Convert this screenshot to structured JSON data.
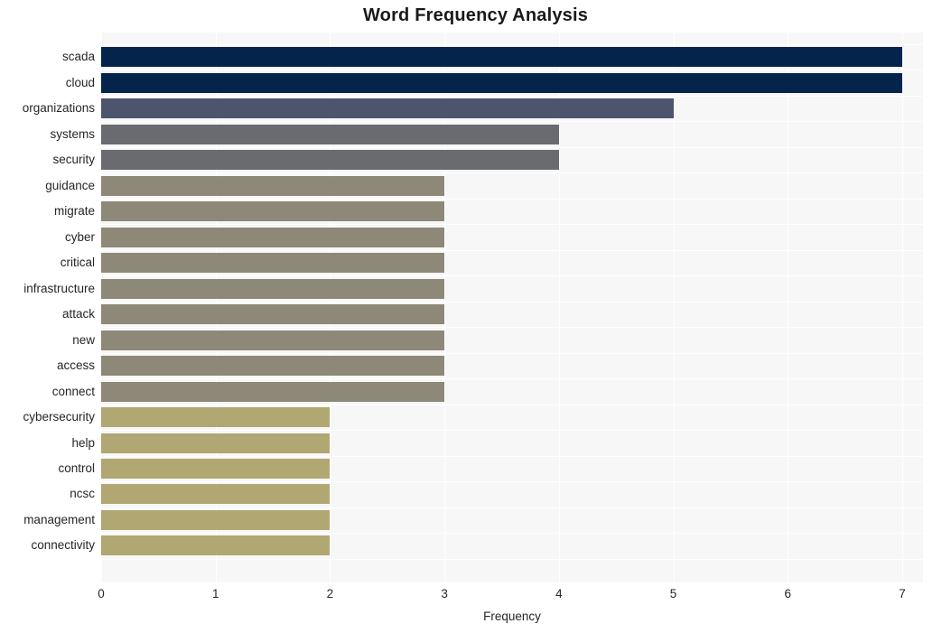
{
  "chart_data": {
    "type": "bar",
    "orientation": "horizontal",
    "title": "Word Frequency Analysis",
    "xlabel": "Frequency",
    "ylabel": "",
    "xlim": [
      0,
      7
    ],
    "xticks": [
      "0",
      "1",
      "2",
      "3",
      "4",
      "5",
      "6",
      "7"
    ],
    "grid": true,
    "legend": false,
    "categories": [
      "scada",
      "cloud",
      "organizations",
      "systems",
      "security",
      "guidance",
      "migrate",
      "cyber",
      "critical",
      "infrastructure",
      "attack",
      "new",
      "access",
      "connect",
      "cybersecurity",
      "help",
      "control",
      "ncsc",
      "management",
      "connectivity"
    ],
    "values": [
      7,
      7,
      5,
      4,
      4,
      3,
      3,
      3,
      3,
      3,
      3,
      3,
      3,
      3,
      2,
      2,
      2,
      2,
      2,
      2
    ],
    "bar_colors": [
      "#04244c",
      "#04244c",
      "#4d546d",
      "#6a6b70",
      "#6a6b70",
      "#8d8878",
      "#8d8878",
      "#8d8878",
      "#8d8878",
      "#8d8878",
      "#8d8878",
      "#8d8878",
      "#8d8878",
      "#8d8878",
      "#b0a772",
      "#b0a772",
      "#b0a772",
      "#b0a772",
      "#b0a772",
      "#b0a772"
    ],
    "plot_background": "#f7f7f7",
    "gridline_color": "#ffffff",
    "figure_background": "#ffffff"
  }
}
